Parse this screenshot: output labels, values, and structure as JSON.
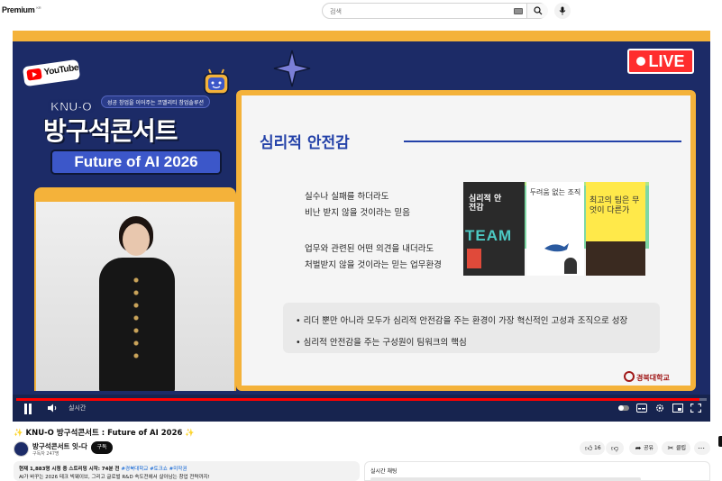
{
  "header": {
    "logo": "Premium",
    "logo_sup": "KR",
    "search_placeholder": "검색"
  },
  "video": {
    "tagline": "성공 창업을 이어주는 코밸리티 창업솔루션",
    "youtube_word": "YouTube",
    "knu_o": "KNU-O",
    "concert": "방구석콘서트",
    "future": "Future of AI 2026",
    "live": "LIVE",
    "slide": {
      "title": "심리적 안전감",
      "definition_1": [
        "실수나 실패를 하더라도",
        "비난 받지 않을 것이라는 믿음"
      ],
      "definition_2": [
        "업무와 관련된 어떤 의견을 내더라도",
        "처벌받지 않을 것이라는 믿는 업무환경"
      ],
      "bullets": [
        "리더 뿐만 아니라 모두가 심리적 안전감을 주는 환경이 가장 혁신적인 고성과 조직으로 성장",
        "심리적 안전감을 주는 구성원이 팀워크의 핵심"
      ],
      "books": [
        "심리적 안전감",
        "두려움 없는 조직",
        "최고의 팀은 무엇이 다른가"
      ],
      "book_team": "TEAM",
      "university": "경북대학교"
    },
    "progress_fraction": 0.99,
    "live_label": "실시간"
  },
  "info": {
    "title": "✨ KNU-O 방구석콘서트 : Future of AI 2026 ✨",
    "channel": "방구석콘서트 잇-다",
    "subs": "구독자 247명",
    "subscribe": "구독",
    "likes": "16",
    "share": "공유",
    "clip": "클립",
    "desc_line1": "현재 1,883명 시청 중  스트리밍 시작: 74분 전",
    "desc_tags": "#경북대학교 #토크쇼 #미작권",
    "desc_line2": "AI가 바꾸는 2026 테크 빅웨이브, 그리고 글로벌 R&D 속도전에서 살아남는 창업 전략까지!",
    "chat_title": "실시간 채팅"
  },
  "colors": {
    "player_bg": "#1c2b67",
    "accent_yellow": "#f4b23a",
    "live_red": "#ff2d2d",
    "slide_title": "#2341a8"
  }
}
